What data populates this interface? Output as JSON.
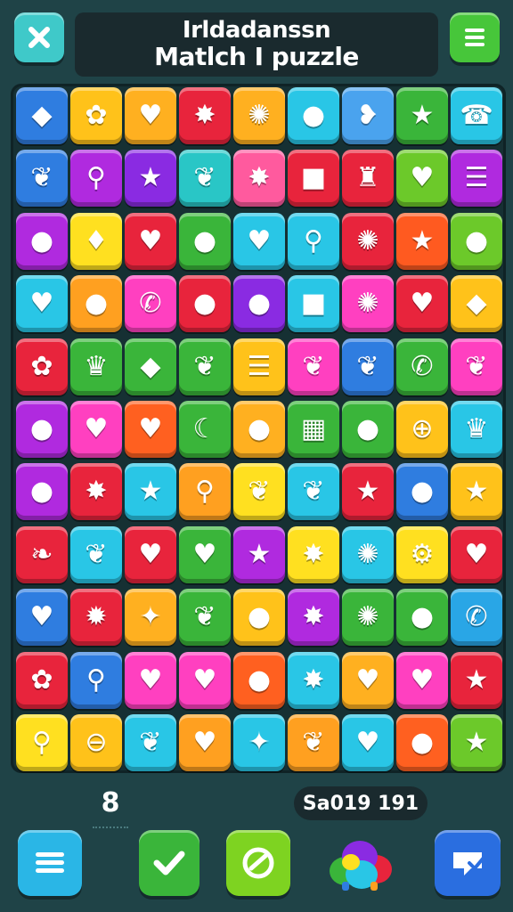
{
  "header": {
    "title_line1": "Irldadanssn",
    "title_line2": "Matlch I puzzle",
    "close_icon": "close-icon",
    "menu_icon": "menu-icon",
    "close_color": "#3fc9c9",
    "menu_color": "#47c63a"
  },
  "board": {
    "rows": [
      [
        {
          "c": "#2f7de0",
          "i": "◆"
        },
        {
          "c": "#ffc21a",
          "i": "✿"
        },
        {
          "c": "#ffb020",
          "i": "♥"
        },
        {
          "c": "#e8243c",
          "i": "✸"
        },
        {
          "c": "#ffb020",
          "i": "✺"
        },
        {
          "c": "#29c6e6",
          "i": "●"
        },
        {
          "c": "#4aa3ee",
          "i": "❥"
        },
        {
          "c": "#3ab53a",
          "i": "★"
        },
        {
          "c": "#29c6e6",
          "i": "☎"
        }
      ],
      [
        {
          "c": "#2f7de0",
          "i": "❦"
        },
        {
          "c": "#b02adf",
          "i": "⚲"
        },
        {
          "c": "#8a2be2",
          "i": "★"
        },
        {
          "c": "#29c6c6",
          "i": "❦"
        },
        {
          "c": "#ff5a9e",
          "i": "✸"
        },
        {
          "c": "#e8243c",
          "i": "■"
        },
        {
          "c": "#e8243c",
          "i": "♜"
        },
        {
          "c": "#6cc92a",
          "i": "♥"
        },
        {
          "c": "#b02adf",
          "i": "☰"
        }
      ],
      [
        {
          "c": "#b02adf",
          "i": "●"
        },
        {
          "c": "#ffe020",
          "i": "♦"
        },
        {
          "c": "#e8243c",
          "i": "♥"
        },
        {
          "c": "#3ab53a",
          "i": "●"
        },
        {
          "c": "#29c6e6",
          "i": "♥"
        },
        {
          "c": "#29c6e6",
          "i": "⚲"
        },
        {
          "c": "#e8243c",
          "i": "✺"
        },
        {
          "c": "#ff5a20",
          "i": "★"
        },
        {
          "c": "#6cc92a",
          "i": "●"
        }
      ],
      [
        {
          "c": "#29c6e6",
          "i": "♥"
        },
        {
          "c": "#ffa020",
          "i": "●"
        },
        {
          "c": "#ff40c0",
          "i": "✆"
        },
        {
          "c": "#e8243c",
          "i": "●"
        },
        {
          "c": "#8a2be2",
          "i": "●"
        },
        {
          "c": "#29c6e6",
          "i": "■"
        },
        {
          "c": "#ff40c0",
          "i": "✺"
        },
        {
          "c": "#e8243c",
          "i": "♥"
        },
        {
          "c": "#ffc21a",
          "i": "◆"
        }
      ],
      [
        {
          "c": "#e8243c",
          "i": "✿"
        },
        {
          "c": "#3ab53a",
          "i": "♛"
        },
        {
          "c": "#3ab53a",
          "i": "◆"
        },
        {
          "c": "#3ab53a",
          "i": "❦"
        },
        {
          "c": "#ffc21a",
          "i": "☰"
        },
        {
          "c": "#ff40c0",
          "i": "❦"
        },
        {
          "c": "#2f7de0",
          "i": "❦"
        },
        {
          "c": "#3ab53a",
          "i": "✆"
        },
        {
          "c": "#ff40c0",
          "i": "❦"
        }
      ],
      [
        {
          "c": "#b02adf",
          "i": "●"
        },
        {
          "c": "#ff40c0",
          "i": "♥"
        },
        {
          "c": "#ff6020",
          "i": "♥"
        },
        {
          "c": "#3ab53a",
          "i": "☾"
        },
        {
          "c": "#ffb020",
          "i": "●"
        },
        {
          "c": "#3ab53a",
          "i": "▦"
        },
        {
          "c": "#3ab53a",
          "i": "●"
        },
        {
          "c": "#ffc21a",
          "i": "⊕"
        },
        {
          "c": "#29c6e6",
          "i": "♛"
        }
      ],
      [
        {
          "c": "#b02adf",
          "i": "●"
        },
        {
          "c": "#e8243c",
          "i": "✸"
        },
        {
          "c": "#29c6e6",
          "i": "★"
        },
        {
          "c": "#ffa020",
          "i": "⚲"
        },
        {
          "c": "#ffe020",
          "i": "❦"
        },
        {
          "c": "#29c6e6",
          "i": "❦"
        },
        {
          "c": "#e8243c",
          "i": "★"
        },
        {
          "c": "#2f7de0",
          "i": "●"
        },
        {
          "c": "#ffc21a",
          "i": "★"
        }
      ],
      [
        {
          "c": "#e8243c",
          "i": "❧"
        },
        {
          "c": "#29c6e6",
          "i": "❦"
        },
        {
          "c": "#e8243c",
          "i": "♥"
        },
        {
          "c": "#3ab53a",
          "i": "♥"
        },
        {
          "c": "#b02adf",
          "i": "★"
        },
        {
          "c": "#ffe020",
          "i": "✸"
        },
        {
          "c": "#29c6e6",
          "i": "✺"
        },
        {
          "c": "#ffe020",
          "i": "⚙"
        },
        {
          "c": "#e8243c",
          "i": "♥"
        }
      ],
      [
        {
          "c": "#2f7de0",
          "i": "♥"
        },
        {
          "c": "#e8243c",
          "i": "✹"
        },
        {
          "c": "#ffb020",
          "i": "✦"
        },
        {
          "c": "#3ab53a",
          "i": "❦"
        },
        {
          "c": "#ffc21a",
          "i": "●"
        },
        {
          "c": "#b02adf",
          "i": "✸"
        },
        {
          "c": "#3ab53a",
          "i": "✺"
        },
        {
          "c": "#3ab53a",
          "i": "●"
        },
        {
          "c": "#29a6e6",
          "i": "✆"
        }
      ],
      [
        {
          "c": "#e8243c",
          "i": "✿"
        },
        {
          "c": "#2f7de0",
          "i": "⚲"
        },
        {
          "c": "#ff40c0",
          "i": "♥"
        },
        {
          "c": "#ff40c0",
          "i": "♥"
        },
        {
          "c": "#ff6020",
          "i": "●"
        },
        {
          "c": "#29c6e6",
          "i": "✸"
        },
        {
          "c": "#ffb020",
          "i": "♥"
        },
        {
          "c": "#ff40c0",
          "i": "♥"
        },
        {
          "c": "#e8243c",
          "i": "★"
        }
      ],
      [
        {
          "c": "#ffe020",
          "i": "⚲"
        },
        {
          "c": "#ffc21a",
          "i": "⊖"
        },
        {
          "c": "#29c6e6",
          "i": "❦"
        },
        {
          "c": "#ffa020",
          "i": "♥"
        },
        {
          "c": "#29c6e6",
          "i": "✦"
        },
        {
          "c": "#ffa020",
          "i": "❦"
        },
        {
          "c": "#29c6e6",
          "i": "♥"
        },
        {
          "c": "#ff6020",
          "i": "●"
        },
        {
          "c": "#6cc92a",
          "i": "★"
        }
      ]
    ]
  },
  "status": {
    "moves": "8",
    "score": "Sa019 191"
  },
  "footer": {
    "list_icon": "list-icon",
    "check_icon": "check-icon",
    "hint_icon": "hint-icon",
    "powerup_icon": "powerup-blob-icon",
    "send_icon": "send-icon"
  }
}
